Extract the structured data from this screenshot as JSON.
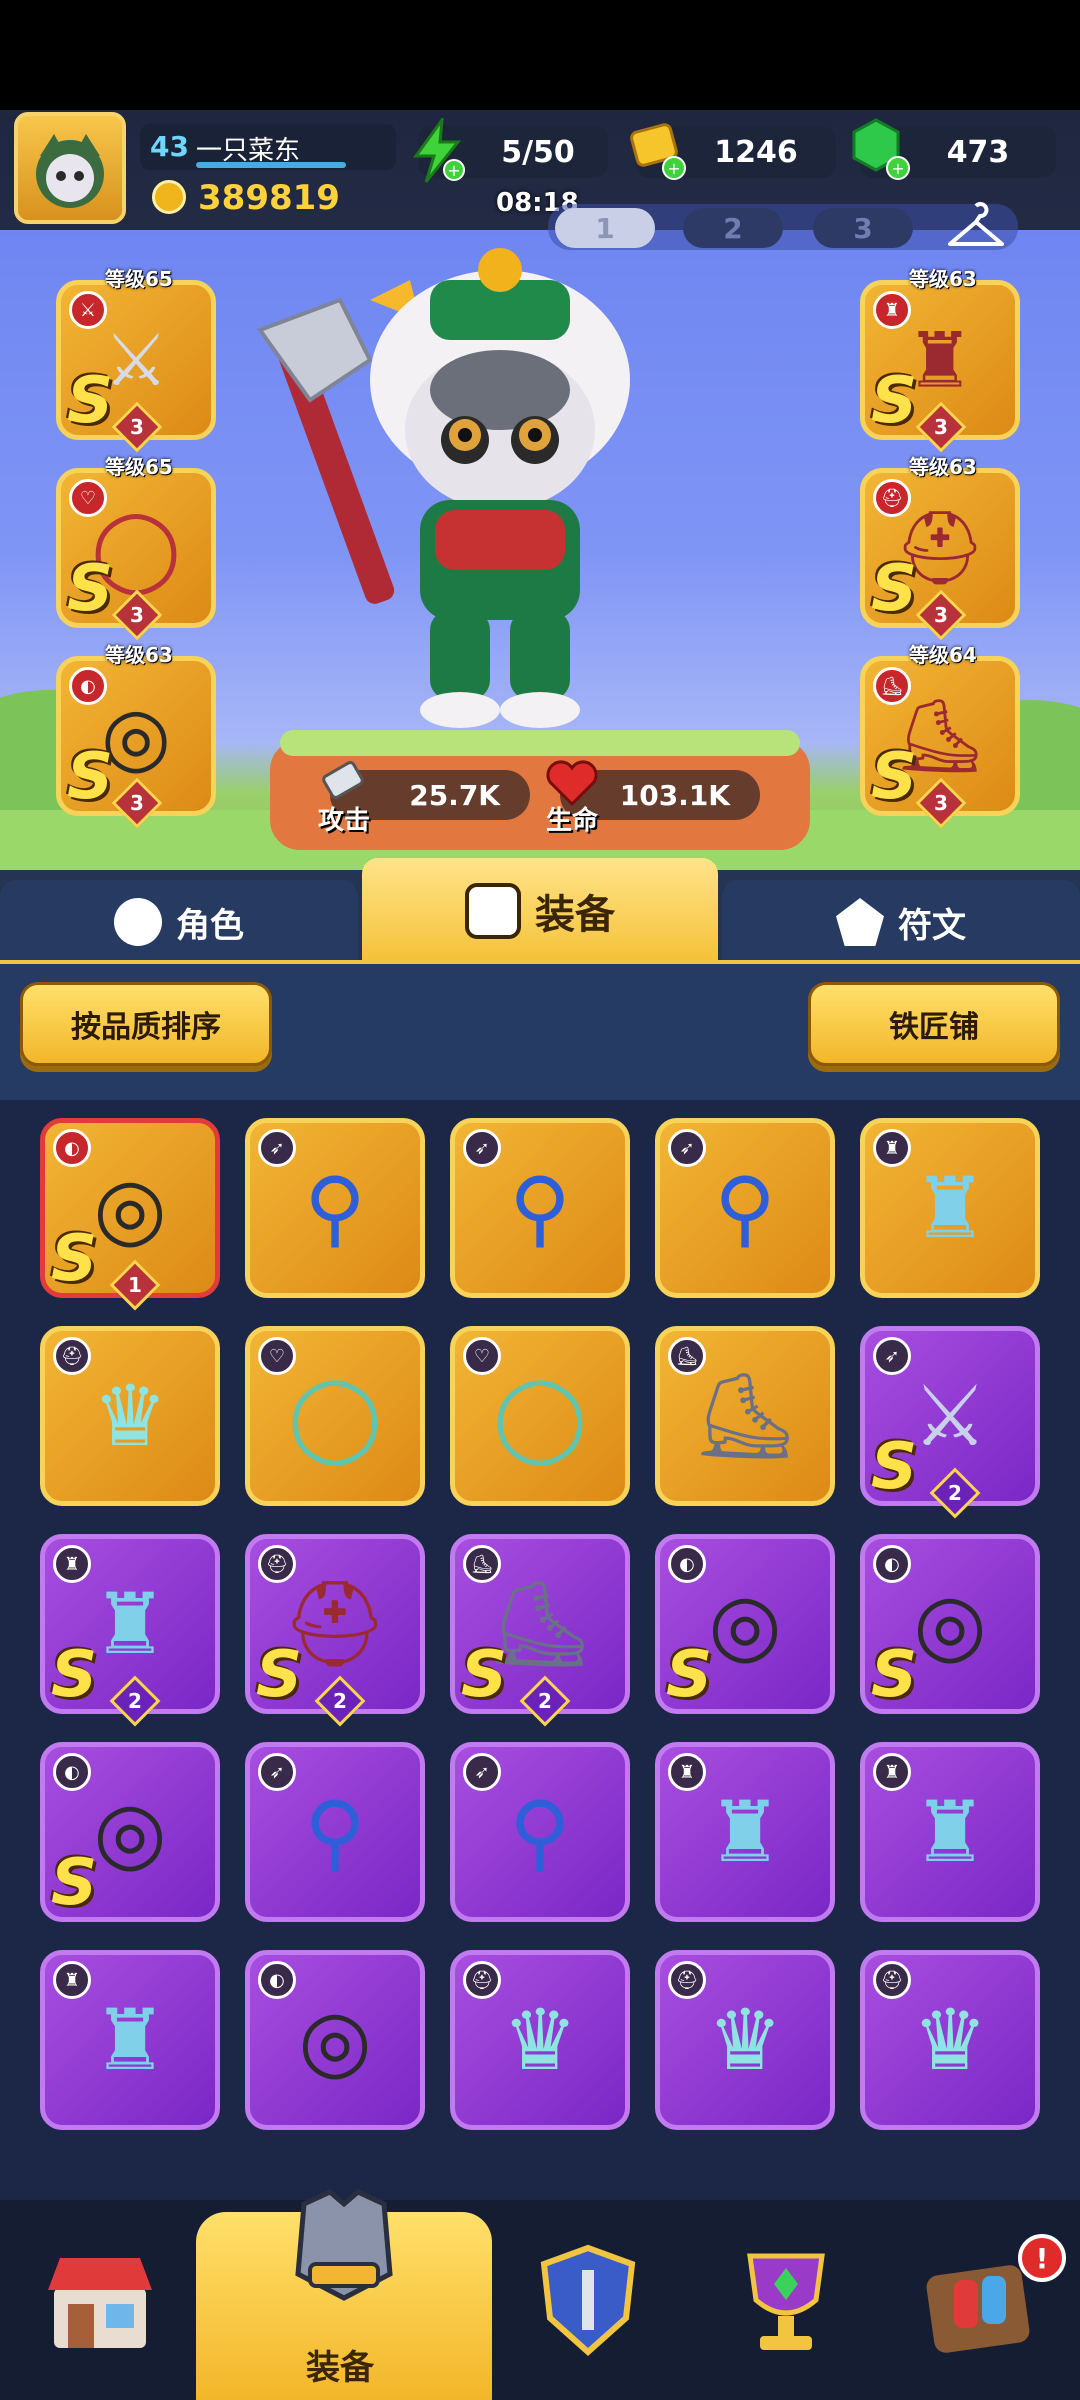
{
  "status_bar": {},
  "player": {
    "level": "43",
    "name": "一只菜东",
    "power": "389819"
  },
  "resources": {
    "energy": "5/50",
    "gold": "1246",
    "gems": "473"
  },
  "timer": "08:18",
  "loadouts": [
    "1",
    "2",
    "3"
  ],
  "equipped_left": [
    {
      "level_label": "等级65",
      "grade": "S",
      "stars": "3",
      "icon": "sword-icon"
    },
    {
      "level_label": "等级65",
      "grade": "S",
      "stars": "3",
      "icon": "necklace-icon"
    },
    {
      "level_label": "等级63",
      "grade": "S",
      "stars": "3",
      "icon": "ring-icon"
    }
  ],
  "equipped_right": [
    {
      "level_label": "等级63",
      "grade": "S",
      "stars": "3",
      "icon": "armor-icon"
    },
    {
      "level_label": "等级63",
      "grade": "S",
      "stars": "3",
      "icon": "helmet-icon"
    },
    {
      "level_label": "等级64",
      "grade": "S",
      "stars": "3",
      "icon": "boots-icon"
    }
  ],
  "stats": {
    "attack_label": "攻击",
    "attack_value": "25.7K",
    "hp_label": "生命",
    "hp_value": "103.1K"
  },
  "tabs": {
    "character": "角色",
    "equipment": "装备",
    "runes": "符文"
  },
  "toolbar": {
    "sort_label": "按品质排序",
    "blacksmith_label": "铁匠铺"
  },
  "inventory": [
    {
      "rarity": "goldred",
      "icon": "ring-icon",
      "grade": "S",
      "stars": "1",
      "glyph": "◎"
    },
    {
      "rarity": "gold",
      "icon": "staff-icon",
      "grade": "",
      "stars": "",
      "glyph": "⚲"
    },
    {
      "rarity": "gold",
      "icon": "staff-icon",
      "grade": "",
      "stars": "",
      "glyph": "⚲"
    },
    {
      "rarity": "gold",
      "icon": "staff-icon",
      "grade": "",
      "stars": "",
      "glyph": "⚲"
    },
    {
      "rarity": "gold",
      "icon": "armor-icon",
      "grade": "",
      "stars": "",
      "glyph": "♜"
    },
    {
      "rarity": "gold",
      "icon": "crown-icon",
      "grade": "",
      "stars": "",
      "glyph": "♛"
    },
    {
      "rarity": "gold",
      "icon": "necklace-icon",
      "grade": "",
      "stars": "",
      "glyph": "◯"
    },
    {
      "rarity": "gold",
      "icon": "necklace-icon",
      "grade": "",
      "stars": "",
      "glyph": "◯"
    },
    {
      "rarity": "gold",
      "icon": "boots-icon",
      "grade": "",
      "stars": "",
      "glyph": "⛸"
    },
    {
      "rarity": "purple",
      "icon": "sword-icon",
      "grade": "S",
      "stars": "2",
      "glyph": "⚔"
    },
    {
      "rarity": "purple",
      "icon": "armor-icon",
      "grade": "S",
      "stars": "2",
      "glyph": "♜"
    },
    {
      "rarity": "purple",
      "icon": "helmet-icon",
      "grade": "S",
      "stars": "2",
      "glyph": "⛑"
    },
    {
      "rarity": "purple",
      "icon": "boots-icon",
      "grade": "S",
      "stars": "2",
      "glyph": "⛸"
    },
    {
      "rarity": "purple",
      "icon": "ring-icon",
      "grade": "S",
      "stars": "",
      "glyph": "◎"
    },
    {
      "rarity": "purple",
      "icon": "ring-icon",
      "grade": "S",
      "stars": "",
      "glyph": "◎"
    },
    {
      "rarity": "purple",
      "icon": "ring-icon",
      "grade": "S",
      "stars": "",
      "glyph": "◎"
    },
    {
      "rarity": "purple",
      "icon": "staff-icon",
      "grade": "",
      "stars": "",
      "glyph": "⚲"
    },
    {
      "rarity": "purple",
      "icon": "staff-icon",
      "grade": "",
      "stars": "",
      "glyph": "⚲"
    },
    {
      "rarity": "purple",
      "icon": "armor-icon",
      "grade": "",
      "stars": "",
      "glyph": "♜"
    },
    {
      "rarity": "purple",
      "icon": "armor-icon",
      "grade": "",
      "stars": "",
      "glyph": "♜"
    },
    {
      "rarity": "purple",
      "icon": "armor-icon",
      "grade": "",
      "stars": "",
      "glyph": "♜"
    },
    {
      "rarity": "purple",
      "icon": "ring-icon",
      "grade": "",
      "stars": "",
      "glyph": "◎"
    },
    {
      "rarity": "purple",
      "icon": "crown-icon",
      "grade": "",
      "stars": "",
      "glyph": "♛"
    },
    {
      "rarity": "purple",
      "icon": "crown-icon",
      "grade": "",
      "stars": "",
      "glyph": "♛"
    },
    {
      "rarity": "purple",
      "icon": "crown-icon",
      "grade": "",
      "stars": "",
      "glyph": "♛"
    }
  ],
  "bottom_nav": {
    "shop": "shop-icon",
    "equipment_label": "装备",
    "talent": "shield-icon",
    "trophy": "trophy-icon",
    "events": "events-icon",
    "events_badge": "!"
  },
  "colors": {
    "gold": "#f2b534",
    "purple": "#8d36d4",
    "accent_yellow": "#f6c93c",
    "panel_bg": "#1e2c4c"
  }
}
